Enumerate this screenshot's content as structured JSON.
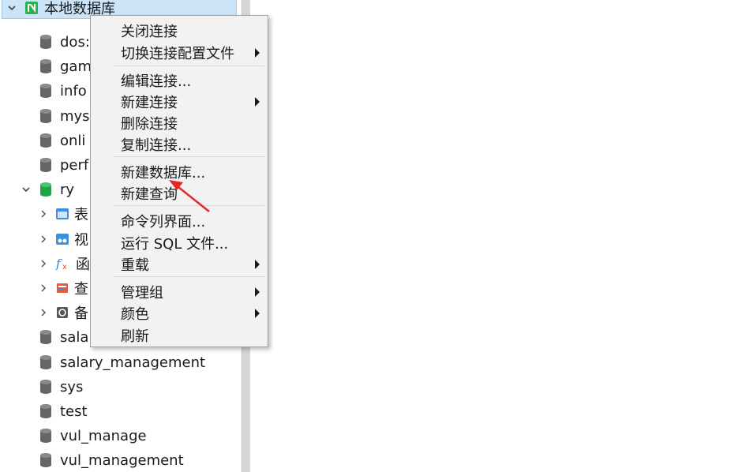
{
  "tree": {
    "connection": {
      "label": "本地数据库",
      "icon": "navicat-connection-icon"
    },
    "databases_top": [
      "dos:",
      "gam",
      "info",
      "mys",
      "onli",
      "perf"
    ],
    "active_db": {
      "label": "ry"
    },
    "children": [
      {
        "label": "表",
        "icon": "table-icon"
      },
      {
        "label": "视",
        "icon": "view-icon"
      },
      {
        "label": "函",
        "icon": "function-icon"
      },
      {
        "label": "查",
        "icon": "query-icon"
      },
      {
        "label": "备",
        "icon": "backup-icon"
      }
    ],
    "databases_bottom": [
      "salar",
      "salary_management",
      "sys",
      "test",
      "vul_manage",
      "vul_management"
    ]
  },
  "context_menu": {
    "items": [
      {
        "label": "关闭连接",
        "submenu": false
      },
      {
        "label": "切换连接配置文件",
        "submenu": true
      },
      {
        "label": "编辑连接...",
        "submenu": false
      },
      {
        "label": "新建连接",
        "submenu": true
      },
      {
        "label": "删除连接",
        "submenu": false
      },
      {
        "label": "复制连接...",
        "submenu": false
      },
      {
        "label": "新建数据库...",
        "submenu": false
      },
      {
        "label": "新建查询",
        "submenu": false
      },
      {
        "label": "命令列界面...",
        "submenu": false
      },
      {
        "label": "运行 SQL 文件...",
        "submenu": false
      },
      {
        "label": "重载",
        "submenu": true
      },
      {
        "label": "管理组",
        "submenu": true
      },
      {
        "label": "颜色",
        "submenu": true
      },
      {
        "label": "刷新",
        "submenu": false
      }
    ]
  },
  "colors": {
    "selection_bg": "#cce4f7",
    "annotation_arrow": "#e8262a",
    "connection_icon": "#2bb24c",
    "active_db_icon": "#1fa34a"
  }
}
